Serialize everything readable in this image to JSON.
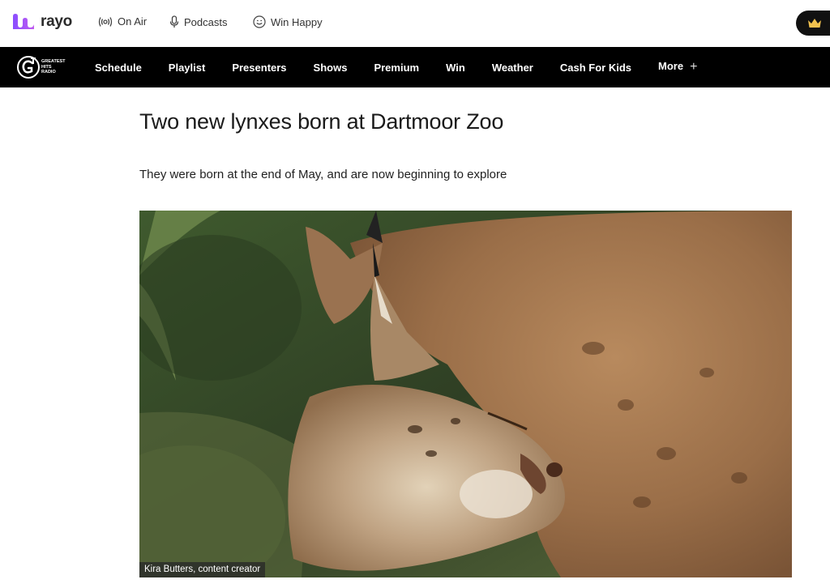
{
  "brand": {
    "name": "rayo"
  },
  "top_nav": [
    {
      "label": "On Air",
      "icon": "radio-waves-icon"
    },
    {
      "label": "Podcasts",
      "icon": "microphone-icon"
    },
    {
      "label": "Win Happy",
      "icon": "smiley-icon"
    }
  ],
  "premium_badge": {
    "icon": "crown-icon",
    "color": "#f2c14e"
  },
  "station": {
    "logo_text": [
      "GREATEST",
      "HITS",
      "RADIO"
    ],
    "nav": [
      "Schedule",
      "Playlist",
      "Presenters",
      "Shows",
      "Premium",
      "Win",
      "Weather",
      "Cash For Kids"
    ],
    "more_label": "More",
    "more_icon": "plus-icon"
  },
  "article": {
    "title": "Two new lynxes born at Dartmoor Zoo",
    "subtitle": "They were born at the end of May, and are now beginning to explore",
    "image_caption": "Kira Butters, content creator"
  },
  "colors": {
    "accent": "#9b5de5",
    "nav_bg": "#000000",
    "text": "#1a1a1a"
  }
}
